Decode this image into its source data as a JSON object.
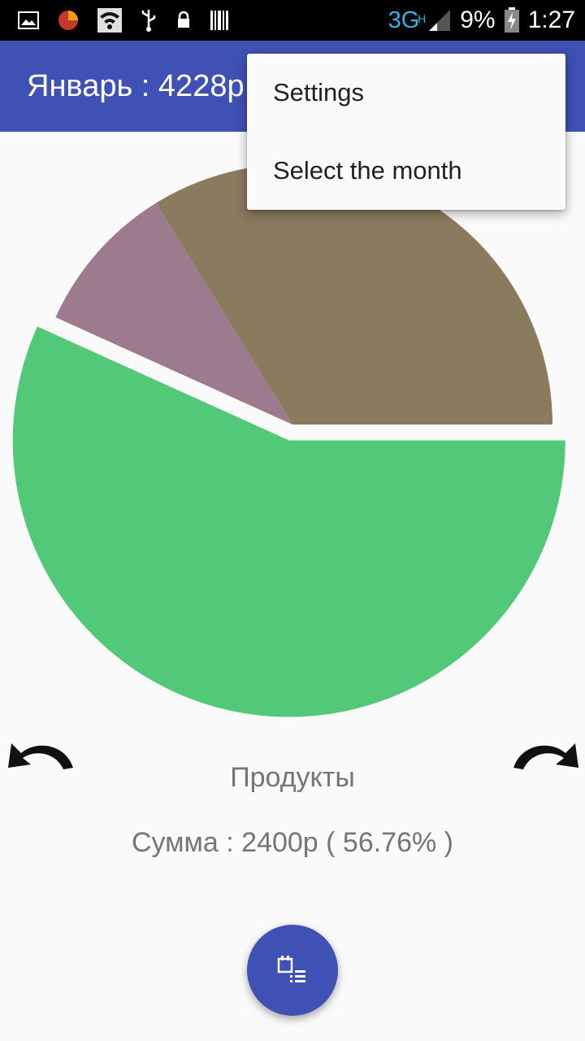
{
  "status_bar": {
    "network_type": "3G",
    "network_sub": "H",
    "battery_percent": "9%",
    "time": "1:27"
  },
  "app_bar": {
    "title": "Январь : 4228р",
    "background_color": "#3f51b5"
  },
  "overflow_menu": {
    "items": [
      {
        "label": "Settings"
      },
      {
        "label": "Select the month"
      }
    ]
  },
  "chart_data": {
    "type": "pie",
    "slices": [
      {
        "name": "Продукты",
        "value": 2400,
        "percent": 56.76,
        "color": "#51c978",
        "selected": true
      },
      {
        "name": "",
        "percent": 9.45,
        "color": "#9b7b8d"
      },
      {
        "name": "",
        "percent": 33.79,
        "color": "#8a7a5e"
      }
    ],
    "total": 4228
  },
  "selected_category": {
    "name": "Продукты",
    "sum_text": "Сумма : 2400р ( 56.76% )"
  },
  "icons": {
    "prev": "undo-arrow-icon",
    "next": "redo-arrow-icon",
    "fab": "calendar-list-icon"
  },
  "fab": {
    "color": "#3f51b5"
  }
}
